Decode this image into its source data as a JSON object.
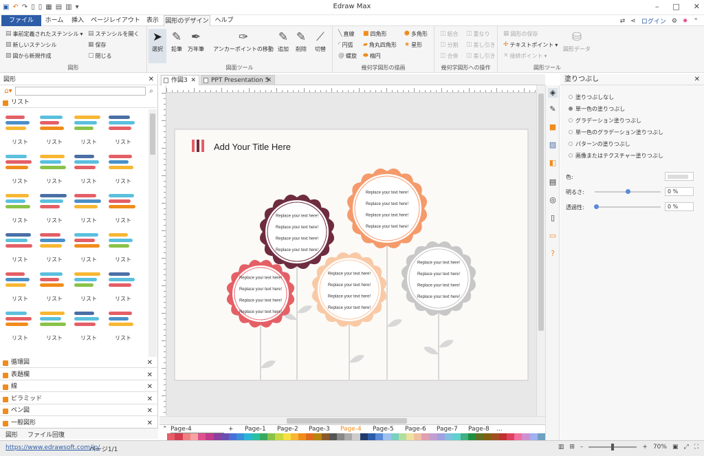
{
  "app": {
    "title": "Edraw Max",
    "login": "ログイン"
  },
  "menu": {
    "items": [
      "ファイル",
      "ホーム",
      "挿入",
      "ページレイアウト",
      "表示",
      "図形のデザイン",
      "ヘルプ"
    ],
    "active": "図形のデザイン"
  },
  "ribbon": {
    "shapes": {
      "label": "図形",
      "predefined": "事前定義されたステンシル",
      "open": "ステンシルを開く",
      "new_stencil": "新しいステンシル",
      "save": "保存",
      "create_from": "図から新規作成",
      "close": "閉じる"
    },
    "tools": {
      "label": "図面ツール",
      "select": "選択",
      "pencil": "鉛筆",
      "fountain_pen": "万年筆",
      "anchor_move": "アンカーポイントの移動",
      "add": "追加",
      "delete": "削除",
      "cut": "切替"
    },
    "geometry": {
      "label": "幾何学図形の描画",
      "line": "直線",
      "rect": "四角形",
      "polygon": "多角形",
      "arc": "円弧",
      "rounded_rect": "角丸四角形",
      "star": "星形",
      "spiral": "螺旋",
      "ellipse": "楕円"
    },
    "operations": {
      "label": "幾何学図形への操作",
      "combine": "結合",
      "overlap": "重なり",
      "split": "分割",
      "subtract": "差し引き",
      "union": "合併",
      "subtract2": "差し引き"
    },
    "shape_tools": {
      "label": "図形ツール",
      "save_shape": "図形の保存",
      "text_point": "テキストポイント",
      "connect_point": "接続ポイント",
      "shape_data": "図形データ"
    }
  },
  "left_panel": {
    "title": "図形",
    "library": "リスト",
    "item_label": "リスト",
    "categories": [
      "循環図",
      "表題欄",
      "線",
      "ピラミッド",
      "ペン図",
      "一般図形"
    ],
    "tabs": [
      "図形",
      "ファイル回復"
    ]
  },
  "documents": {
    "tabs": [
      "作図3",
      "PPT Presentation 5"
    ]
  },
  "slide": {
    "title": "Add Your Title Here",
    "placeholder": "Replace your text here!",
    "colors": {
      "plum": "#6e2c3f",
      "orange": "#f59a6b",
      "red": "#e45f66",
      "peach": "#f9c9a6",
      "gray": "#c8c8c8",
      "stem": "#d8d8d8",
      "bg": "#fbfaf6"
    }
  },
  "pages": {
    "current": "Page-4",
    "list": [
      "Page-1",
      "Page-2",
      "Page-3",
      "Page-4",
      "Page-5",
      "Page-6",
      "Page-7",
      "Page-8"
    ],
    "more": "..."
  },
  "right_panel": {
    "title": "塗りつぶし",
    "options": [
      "塗りつぶしなし",
      "単一色の塗りつぶし",
      "グラデーション塗りつぶし",
      "単一色のグラデーション塗りつぶし",
      "パターンの塗りつぶし",
      "画像またはテクスチャー塗りつぶし"
    ],
    "selected": 1,
    "color_label": "色:",
    "brightness_label": "明るさ:",
    "brightness_value": "0 %",
    "brightness_level": 0.5,
    "transparency_label": "透過性:",
    "transparency_value": "0 %",
    "transparency_level": 0
  },
  "status": {
    "url": "https://www.edrawsoft.com/jp/",
    "page_info": "ページ1/1",
    "zoom": "70%"
  }
}
